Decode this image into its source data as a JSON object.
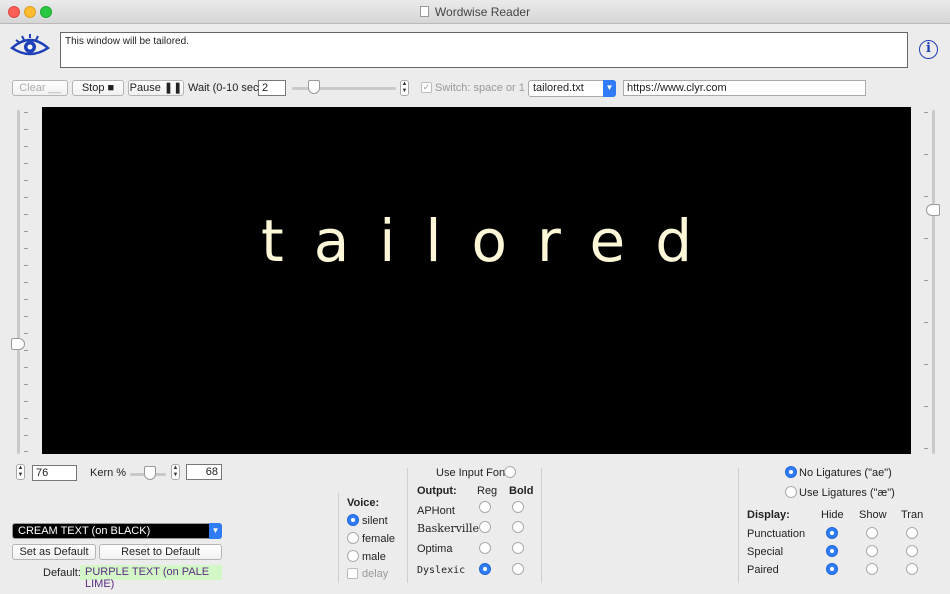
{
  "window": {
    "title": "Wordwise Reader"
  },
  "message": "This window will be tailored.",
  "toolbar": {
    "clear_label": "Clear __",
    "stop_label": "Stop ■",
    "pause_label": "Pause ❚❚",
    "wait_label": "Wait (0-10 sec)",
    "wait_value": "2",
    "switch_label": "Switch: space or 1",
    "switch_checked": true,
    "file_selected": "tailored.txt",
    "url_value": "https://www.clyr.com"
  },
  "display": {
    "word": "tailored"
  },
  "bottom_controls": {
    "size_value": "76",
    "kern_label": "Kern %",
    "kern_value": "68"
  },
  "color_scheme": {
    "selected": "CREAM TEXT (on BLACK)",
    "set_default_label": "Set as Default",
    "reset_default_label": "Reset to Default",
    "default_label": "Default:",
    "default_value": "PURPLE TEXT (on PALE LIME)"
  },
  "voice": {
    "heading": "Voice:",
    "options": [
      {
        "label": "silent",
        "selected": true
      },
      {
        "label": "female",
        "selected": false
      },
      {
        "label": "male",
        "selected": false
      }
    ],
    "delay_label": "delay"
  },
  "output": {
    "use_input_font_label": "Use Input Font",
    "heading": "Output:",
    "col_reg": "Reg",
    "col_bold": "Bold",
    "fonts": [
      {
        "name": "APHont",
        "reg": false,
        "bold": false
      },
      {
        "name": "Baskerville",
        "reg": false,
        "bold": false
      },
      {
        "name": "Optima",
        "reg": false,
        "bold": false
      },
      {
        "name": "Dyslexic",
        "reg": true,
        "bold": false
      }
    ]
  },
  "ligatures": {
    "no_label": "No Ligatures (\"ae\")",
    "use_label": "Use Ligatures (\"æ\")",
    "selected": "no"
  },
  "display_options": {
    "heading": "Display:",
    "col_hide": "Hide",
    "col_show": "Show",
    "col_tran": "Tran",
    "rows": [
      {
        "label": "Punctuation",
        "selected": "hide"
      },
      {
        "label": "Special",
        "selected": "hide"
      },
      {
        "label": "Paired",
        "selected": "hide"
      }
    ]
  }
}
